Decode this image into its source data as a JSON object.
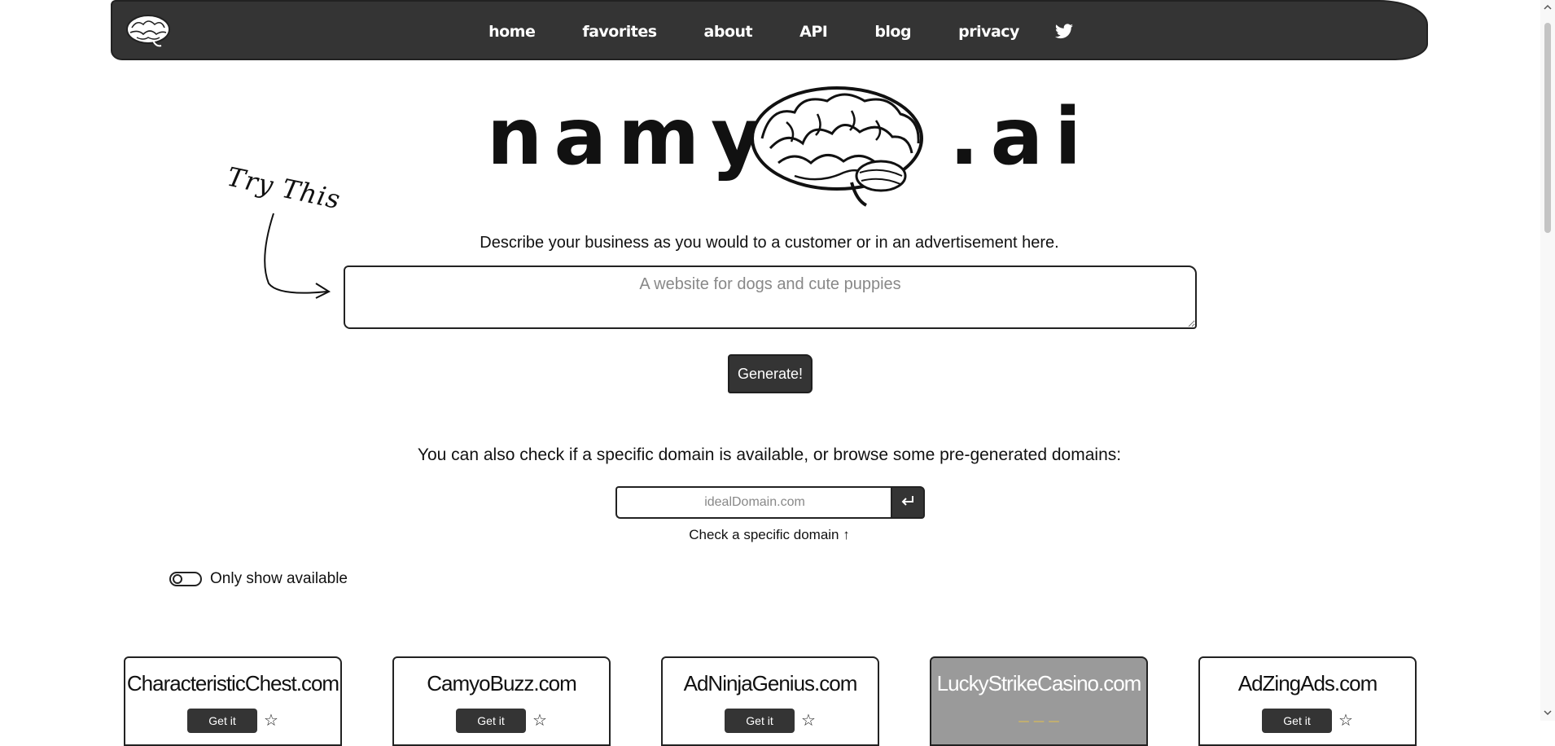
{
  "nav": {
    "logo_icon": "brain-icon",
    "links": [
      "home",
      "favorites",
      "about",
      "API",
      "blog",
      "privacy"
    ],
    "twitter_icon": "twitter-icon"
  },
  "logo": {
    "left": "namy",
    "right": ".ai",
    "brain_icon": "brain-icon"
  },
  "annotation": {
    "try_this": "Try This"
  },
  "describe_text": "Describe your business as you would to a customer or in an advertisement here.",
  "description_placeholder": "A website for dogs and cute puppies",
  "generate_label": "Generate!",
  "also_check_text": "You can also check if a specific domain is available, or browse some pre-generated domains:",
  "domain_placeholder": "idealDomain.com",
  "domain_submit_icon": "enter-icon",
  "check_caption": "Check a specific domain ↑",
  "toggle_label": "Only show available",
  "cards": [
    {
      "name": "CharacteristicChest.com",
      "button": "Get it",
      "available": true
    },
    {
      "name": "CamyoBuzz.com",
      "button": "Get it",
      "available": true
    },
    {
      "name": "AdNinjaGenius.com",
      "button": "Get it",
      "available": true
    },
    {
      "name": "LuckyStrikeCasino.com",
      "button": "",
      "available": false
    },
    {
      "name": "AdZingAds.com",
      "button": "Get it",
      "available": true
    }
  ],
  "colors": {
    "dark": "#343434",
    "unavailable_card": "#9a9a9a"
  }
}
